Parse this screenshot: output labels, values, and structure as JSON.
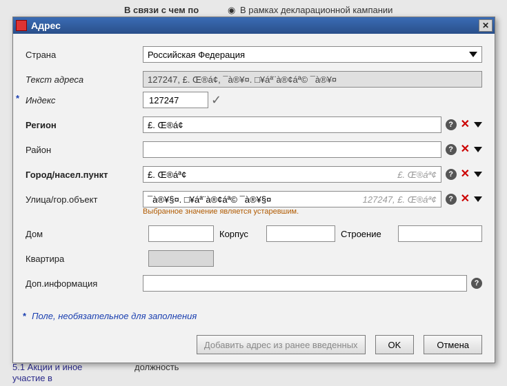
{
  "bg": {
    "line1_bold": "В связи с чем по",
    "line1_radio": "В рамках декларационной кампании",
    "bottom1": "5.1 Акции и иное",
    "bottom2": "участие в",
    "bottom3": "должность"
  },
  "dialog": {
    "title": "Адрес",
    "labels": {
      "country": "Страна",
      "address_text": "Текст адреса",
      "index": "Индекс",
      "region": "Регион",
      "district": "Район",
      "city": "Город/насел.пункт",
      "street": "Улица/гор.объект",
      "house": "Дом",
      "block": "Корпус",
      "building": "Строение",
      "flat": "Квартира",
      "extra": "Доп.информация"
    },
    "values": {
      "country": "Российская Федерация",
      "address_text": "127247, £. Œ®á¢, ¯à®¥¤. □¥áª¨à®¢áª© ¯à®¥¤",
      "index": "127247",
      "region": "£. Œ®á¢",
      "city": "£. Œ®áª¢",
      "city_hint": "£. Œ®áª¢",
      "street": "¯à®¥§¤. □¥áª¨à®¢áª© ¯à®¥§¤",
      "street_hint": "127247, £. Œ®áª¢"
    },
    "warning_text": "Выбранное значение является устаревшим.",
    "footnote": "Поле, необязательное для заполнения",
    "buttons": {
      "add_previous": "Добавить адрес из ранее введенных",
      "ok": "OK",
      "cancel": "Отмена"
    }
  }
}
